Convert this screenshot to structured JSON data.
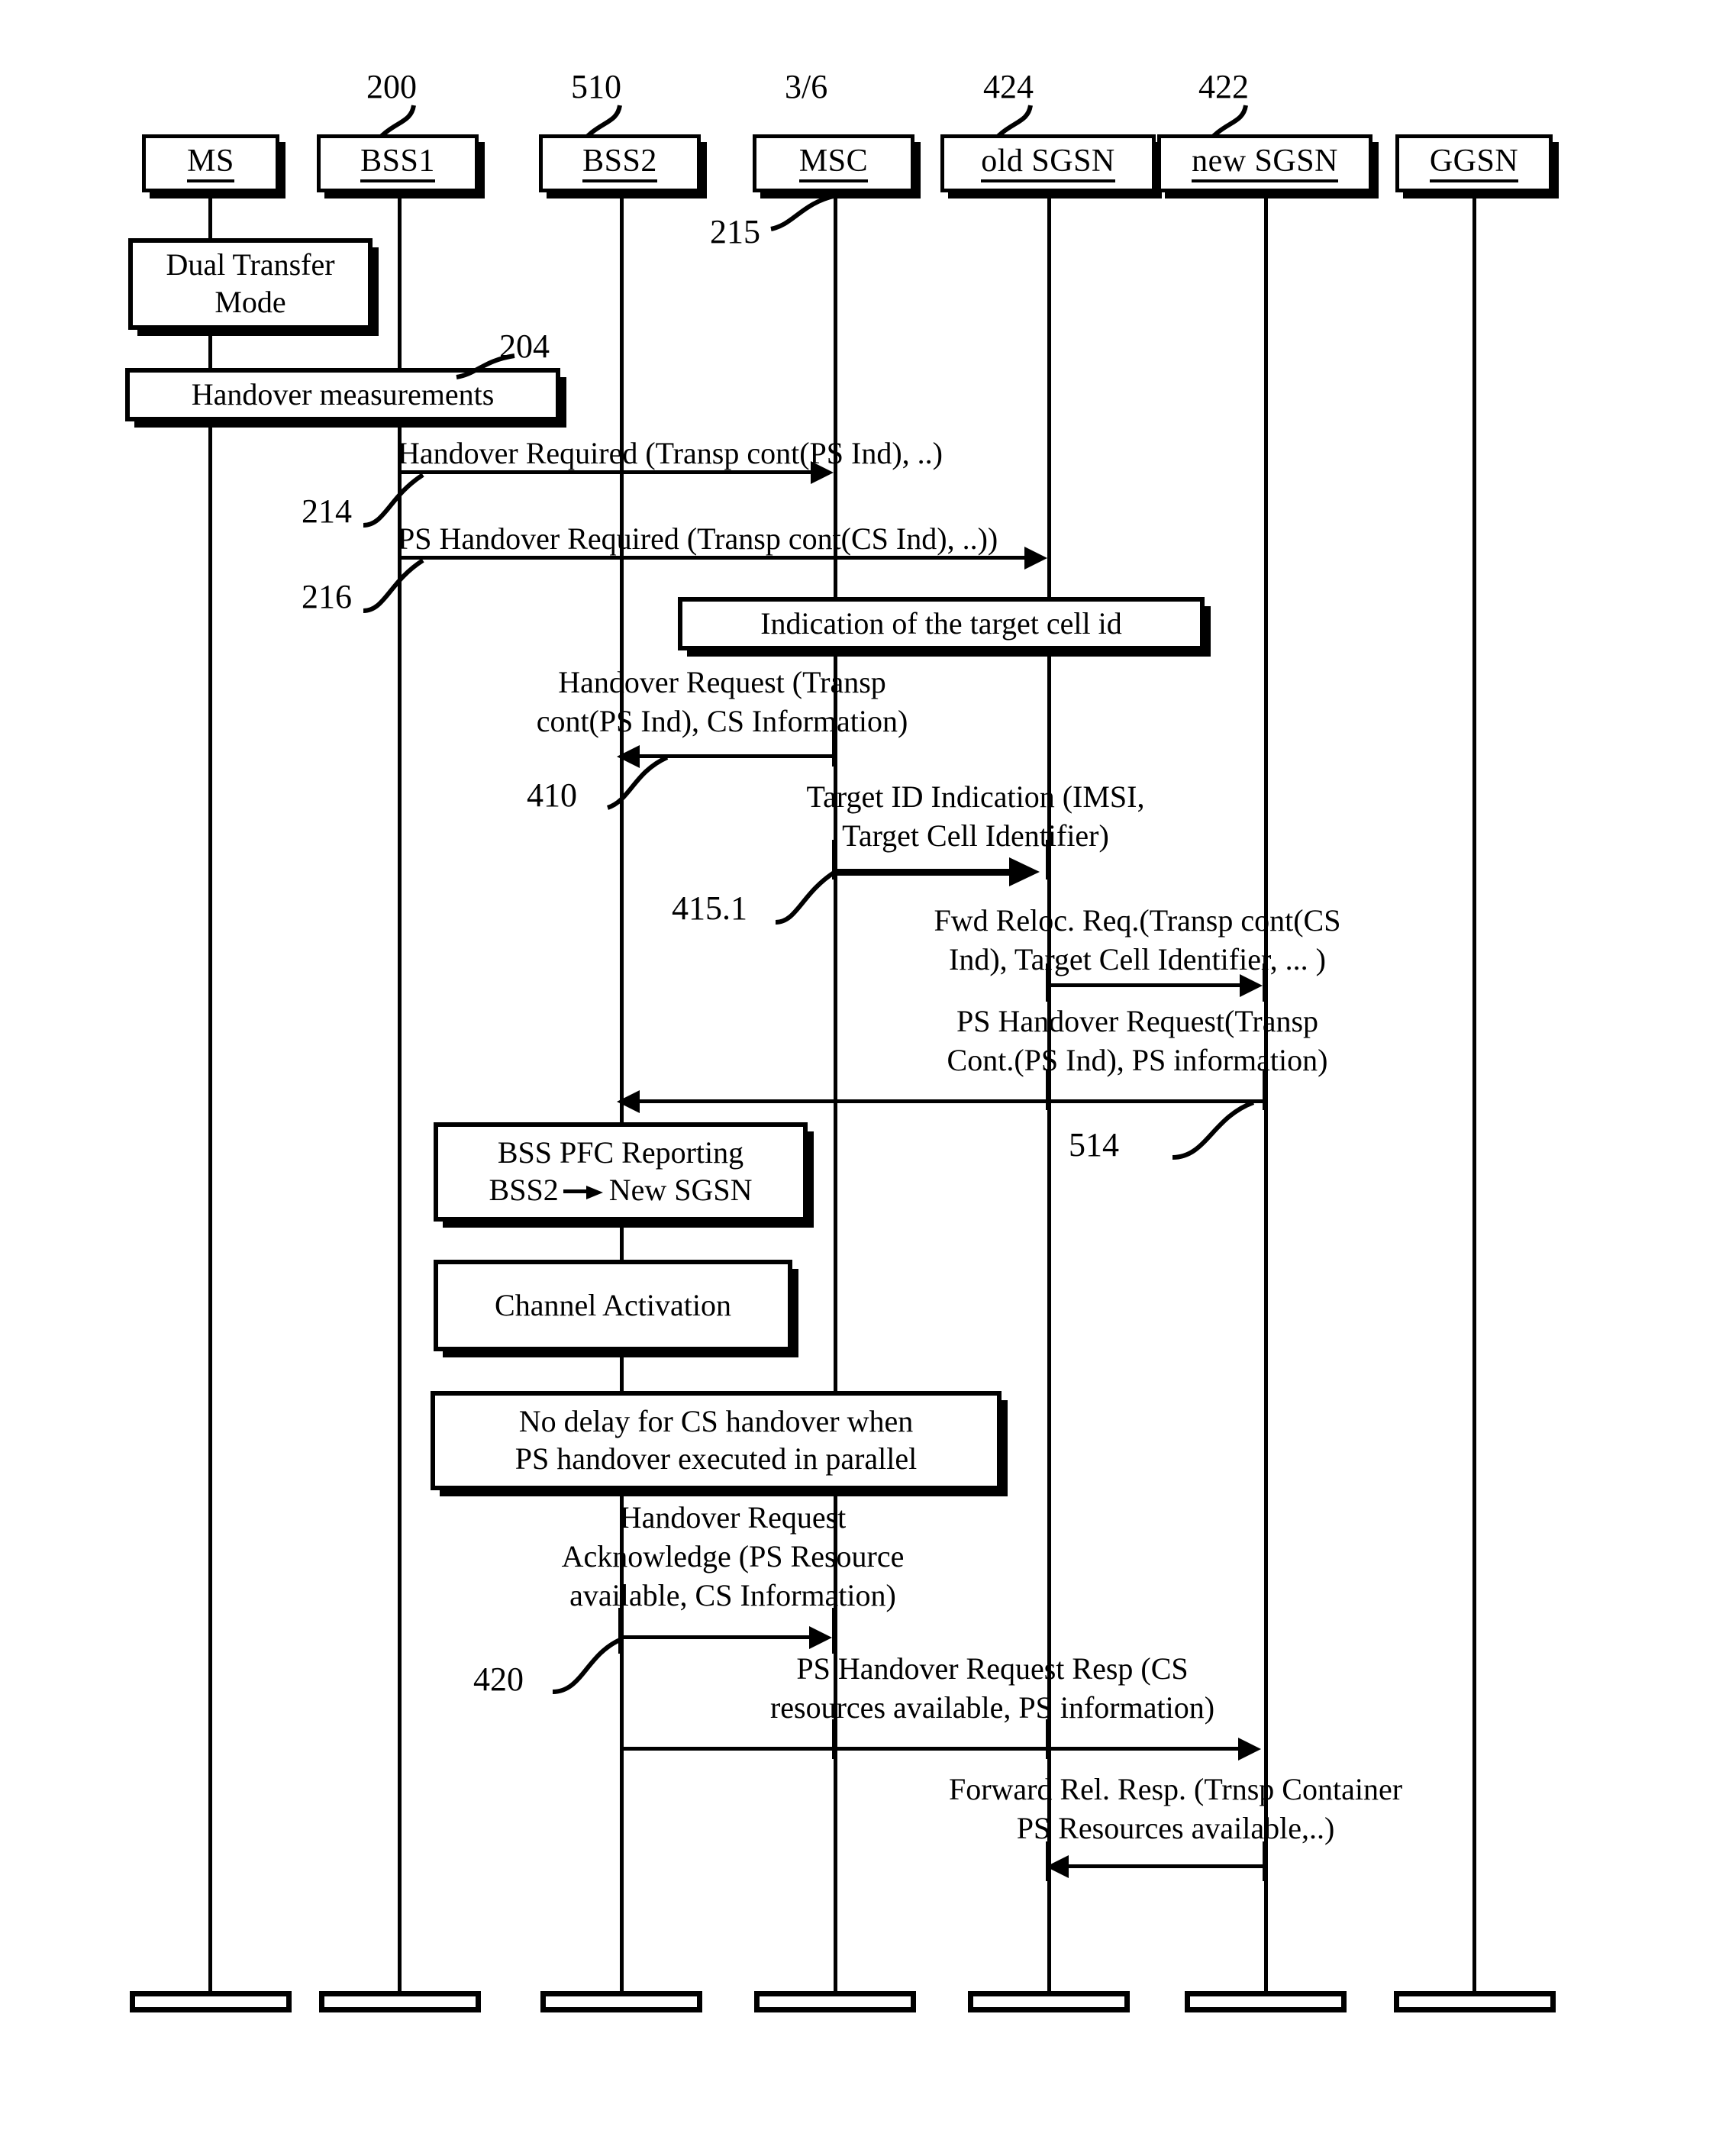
{
  "diagram": {
    "figure_label": "3/6",
    "actors": [
      {
        "id": "ms",
        "label": "MS",
        "ref": null
      },
      {
        "id": "bss1",
        "label": "BSS1",
        "ref": "200"
      },
      {
        "id": "bss2",
        "label": "BSS2",
        "ref": "510"
      },
      {
        "id": "msc",
        "label": "MSC",
        "ref": "215"
      },
      {
        "id": "old_sgsn",
        "label": "old SGSN",
        "ref": "424"
      },
      {
        "id": "new_sgsn",
        "label": "new SGSN",
        "ref": "422"
      },
      {
        "id": "ggsn",
        "label": "GGSN",
        "ref": null
      }
    ],
    "notes": [
      {
        "id": "dual-transfer-mode",
        "lines": [
          "Dual Transfer",
          "Mode"
        ]
      },
      {
        "id": "handover-measurements",
        "lines": [
          "Handover measurements"
        ],
        "ref": "204"
      },
      {
        "id": "indication-target-cell-id",
        "lines": [
          "Indication of the target cell id"
        ]
      },
      {
        "id": "bss-pfc-reporting",
        "lines": [
          "BSS PFC Reporting",
          "BSS2 → New SGSN"
        ],
        "line1": "BSS PFC Reporting",
        "line2_a": "BSS2",
        "line2_b": "New SGSN"
      },
      {
        "id": "channel-activation",
        "lines": [
          "Channel Activation"
        ]
      },
      {
        "id": "no-delay",
        "lines": [
          "No delay for CS handover when",
          "PS handover executed in parallel"
        ]
      }
    ],
    "messages": [
      {
        "id": "handover-required",
        "lines": [
          "Handover Required (Transp cont(PS Ind), ..)"
        ],
        "from": "bss1",
        "to": "msc",
        "dir": "right",
        "ref": "214"
      },
      {
        "id": "ps-handover-required",
        "lines": [
          "PS Handover Required (Transp cont(CS Ind), ..))"
        ],
        "from": "bss1",
        "to": "old_sgsn",
        "dir": "right",
        "ref": "216"
      },
      {
        "id": "handover-request",
        "lines": [
          "Handover Request (Transp",
          "cont(PS Ind), CS Information)"
        ],
        "from": "msc",
        "to": "bss2",
        "dir": "left",
        "ref": "410"
      },
      {
        "id": "target-id-indication",
        "lines": [
          "Target ID Indication (IMSI,",
          "Target Cell Identifier)"
        ],
        "from": "msc",
        "to": "old_sgsn",
        "dir": "right",
        "ref": "415.1"
      },
      {
        "id": "fwd-reloc-req",
        "lines": [
          "Fwd Reloc. Req.(Transp cont(CS",
          "Ind), Target Cell Identifier, ... )"
        ],
        "from": "old_sgsn",
        "to": "new_sgsn",
        "dir": "right",
        "ref": null
      },
      {
        "id": "ps-handover-request",
        "lines": [
          "PS Handover Request(Transp",
          "Cont.(PS Ind), PS information)"
        ],
        "from": "new_sgsn",
        "to": "bss2",
        "dir": "left",
        "ref": "514"
      },
      {
        "id": "handover-request-acknowledge",
        "lines": [
          "Handover Request",
          "Acknowledge (PS Resource",
          "available, CS Information)"
        ],
        "from": "bss2",
        "to": "msc",
        "dir": "right",
        "ref": "420"
      },
      {
        "id": "ps-handover-request-resp",
        "lines": [
          "PS Handover Request Resp (CS",
          "resources available, PS information)"
        ],
        "from": "bss2",
        "to": "new_sgsn",
        "dir": "right",
        "ref": null
      },
      {
        "id": "forward-rel-resp",
        "lines": [
          "Forward Rel. Resp. (Trnsp Container",
          "PS Resources available,..)"
        ],
        "from": "new_sgsn",
        "to": "old_sgsn",
        "dir": "left",
        "ref": null
      }
    ],
    "colors": {
      "ink": "#000000",
      "paper": "#ffffff"
    }
  }
}
